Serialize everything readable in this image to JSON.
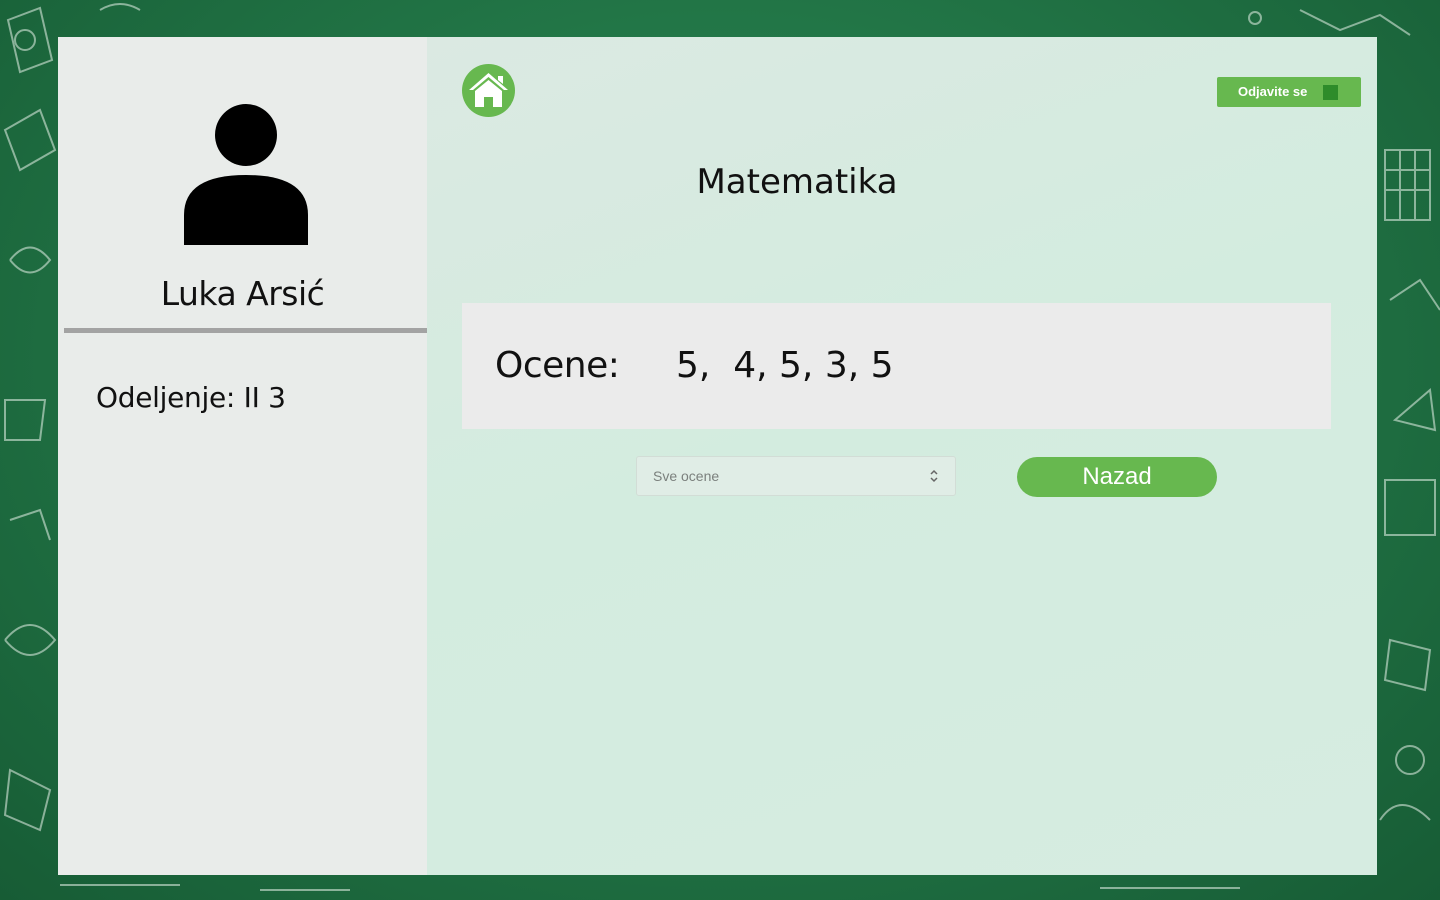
{
  "student": {
    "name": "Luka Arsić",
    "class_label": "Odeljenje: II 3"
  },
  "header": {
    "home_icon": "home-icon",
    "logout_label": "Odjavite se"
  },
  "subject": {
    "title": "Matematika"
  },
  "grades": {
    "label": "Ocene:",
    "values_text": "5,  4, 5, 3, 5"
  },
  "filter": {
    "selected": "Sve ocene"
  },
  "actions": {
    "back_label": "Nazad"
  },
  "colors": {
    "accent_green": "#67b84f",
    "chalkboard": "#23784a"
  }
}
